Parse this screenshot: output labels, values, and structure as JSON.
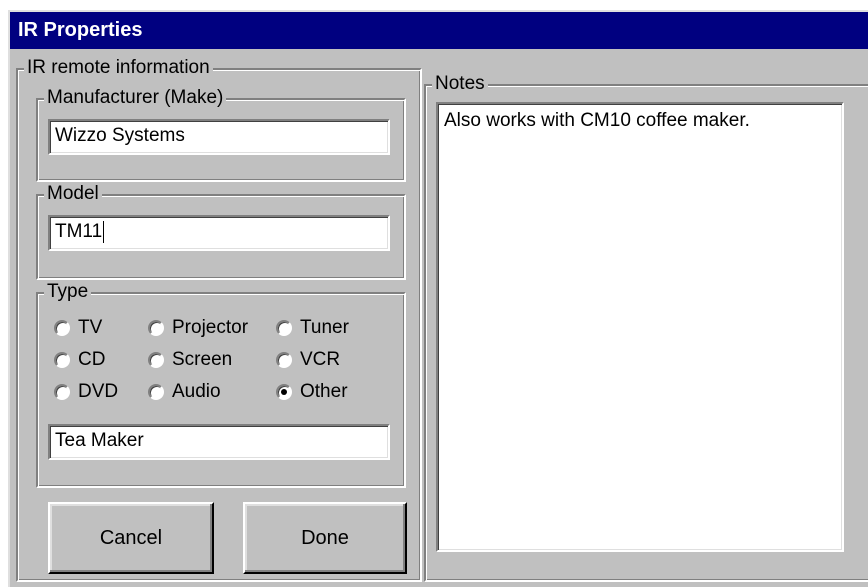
{
  "window": {
    "title": "IR Properties"
  },
  "remote_info": {
    "label": "IR remote information",
    "manufacturer": {
      "label": "Manufacturer (Make)",
      "value": "Wizzo Systems"
    },
    "model": {
      "label": "Model",
      "value": "TM11"
    },
    "type": {
      "label": "Type",
      "options": [
        {
          "label": "TV",
          "checked": false
        },
        {
          "label": "Projector",
          "checked": false
        },
        {
          "label": "Tuner",
          "checked": false
        },
        {
          "label": "CD",
          "checked": false
        },
        {
          "label": "Screen",
          "checked": false
        },
        {
          "label": "VCR",
          "checked": false
        },
        {
          "label": "DVD",
          "checked": false
        },
        {
          "label": "Audio",
          "checked": false
        },
        {
          "label": "Other",
          "checked": true
        }
      ],
      "other_value": "Tea Maker"
    }
  },
  "notes": {
    "label": "Notes",
    "text": "Also works with CM10 coffee maker."
  },
  "buttons": {
    "cancel": "Cancel",
    "done": "Done"
  },
  "colors": {
    "title_bar": "#000080",
    "face": "#c0c0c0"
  }
}
